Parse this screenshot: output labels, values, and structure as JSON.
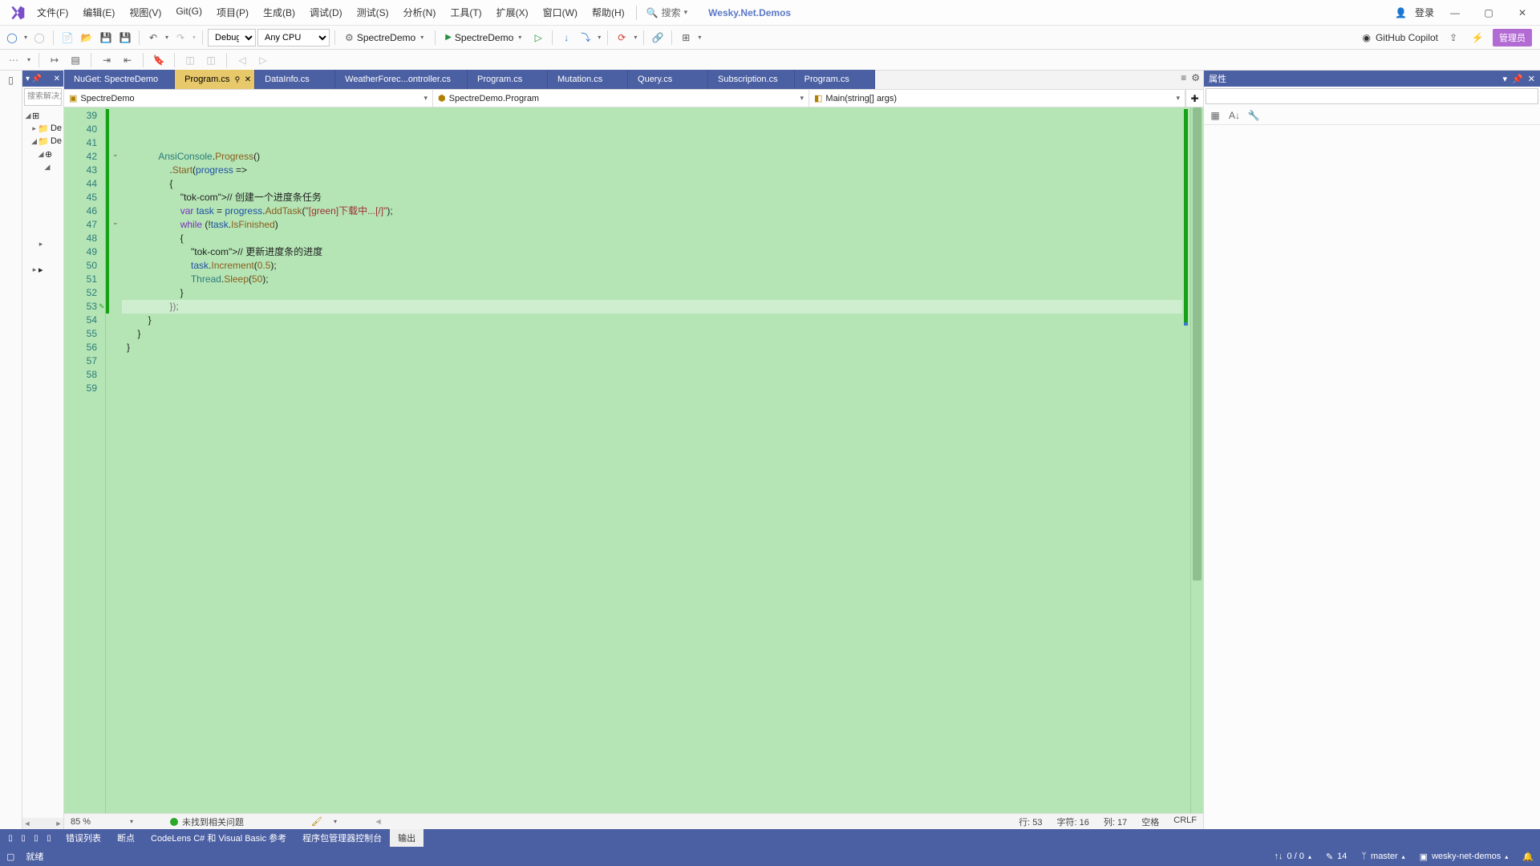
{
  "menubar": {
    "items": [
      "文件(F)",
      "编辑(E)",
      "视图(V)",
      "Git(G)",
      "项目(P)",
      "生成(B)",
      "调试(D)",
      "测试(S)",
      "分析(N)",
      "工具(T)",
      "扩展(X)",
      "窗口(W)",
      "帮助(H)"
    ],
    "search": "搜索",
    "solution": "Wesky.Net.Demos",
    "login": "登录"
  },
  "toolbar": {
    "config": "Debug",
    "platform": "Any CPU",
    "target1": "SpectreDemo",
    "target2": "SpectreDemo",
    "copilot": "GitHub Copilot",
    "admin": "管理员"
  },
  "solutionExplorer": {
    "title": ". ",
    "searchPlaceholder": "搜索解决方",
    "nodes": [
      "De",
      "De"
    ]
  },
  "tabs": [
    {
      "label": "NuGet: SpectreDemo",
      "active": false
    },
    {
      "label": "Program.cs",
      "active": true
    },
    {
      "label": "DataInfo.cs",
      "active": false
    },
    {
      "label": "WeatherForec...ontroller.cs",
      "active": false
    },
    {
      "label": "Program.cs",
      "active": false
    },
    {
      "label": "Mutation.cs",
      "active": false
    },
    {
      "label": "Query.cs",
      "active": false
    },
    {
      "label": "Subscription.cs",
      "active": false
    },
    {
      "label": "Program.cs",
      "active": false
    }
  ],
  "navCombos": {
    "project": "SpectreDemo",
    "class": "SpectreDemo.Program",
    "member": "Main(string[] args)"
  },
  "code": {
    "startLine": 39,
    "lines": [
      "",
      "",
      "            AnsiConsole.Progress()",
      "                .Start(progress =>",
      "                {",
      "                    // 创建一个进度条任务",
      "                    var task = progress.AddTask(\"[green]下载中...[/]\");",
      "",
      "                    while (!task.IsFinished)",
      "                    {",
      "                        // 更新进度条的进度",
      "                        task.Increment(0.5);",
      "                        Thread.Sleep(50);",
      "                    }",
      "                });",
      "",
      "",
      "        }",
      "    }",
      "}",
      ""
    ]
  },
  "editorStatus": {
    "zoom": "85 %",
    "issues": "未找到相关问题",
    "line": "行: 53",
    "char": "字符: 16",
    "col": "列: 17",
    "ins": "空格",
    "eol": "CRLF"
  },
  "outputTabs": [
    "错误列表",
    "断点",
    "CodeLens C# 和 Visual Basic 参考",
    "程序包管理器控制台",
    "输出"
  ],
  "outputActive": 4,
  "propsPanel": {
    "title": "属性"
  },
  "statusbar": {
    "ready": "就绪",
    "updown": "0 / 0",
    "pen": "14",
    "branch": "master",
    "repo": "wesky-net-demos"
  }
}
